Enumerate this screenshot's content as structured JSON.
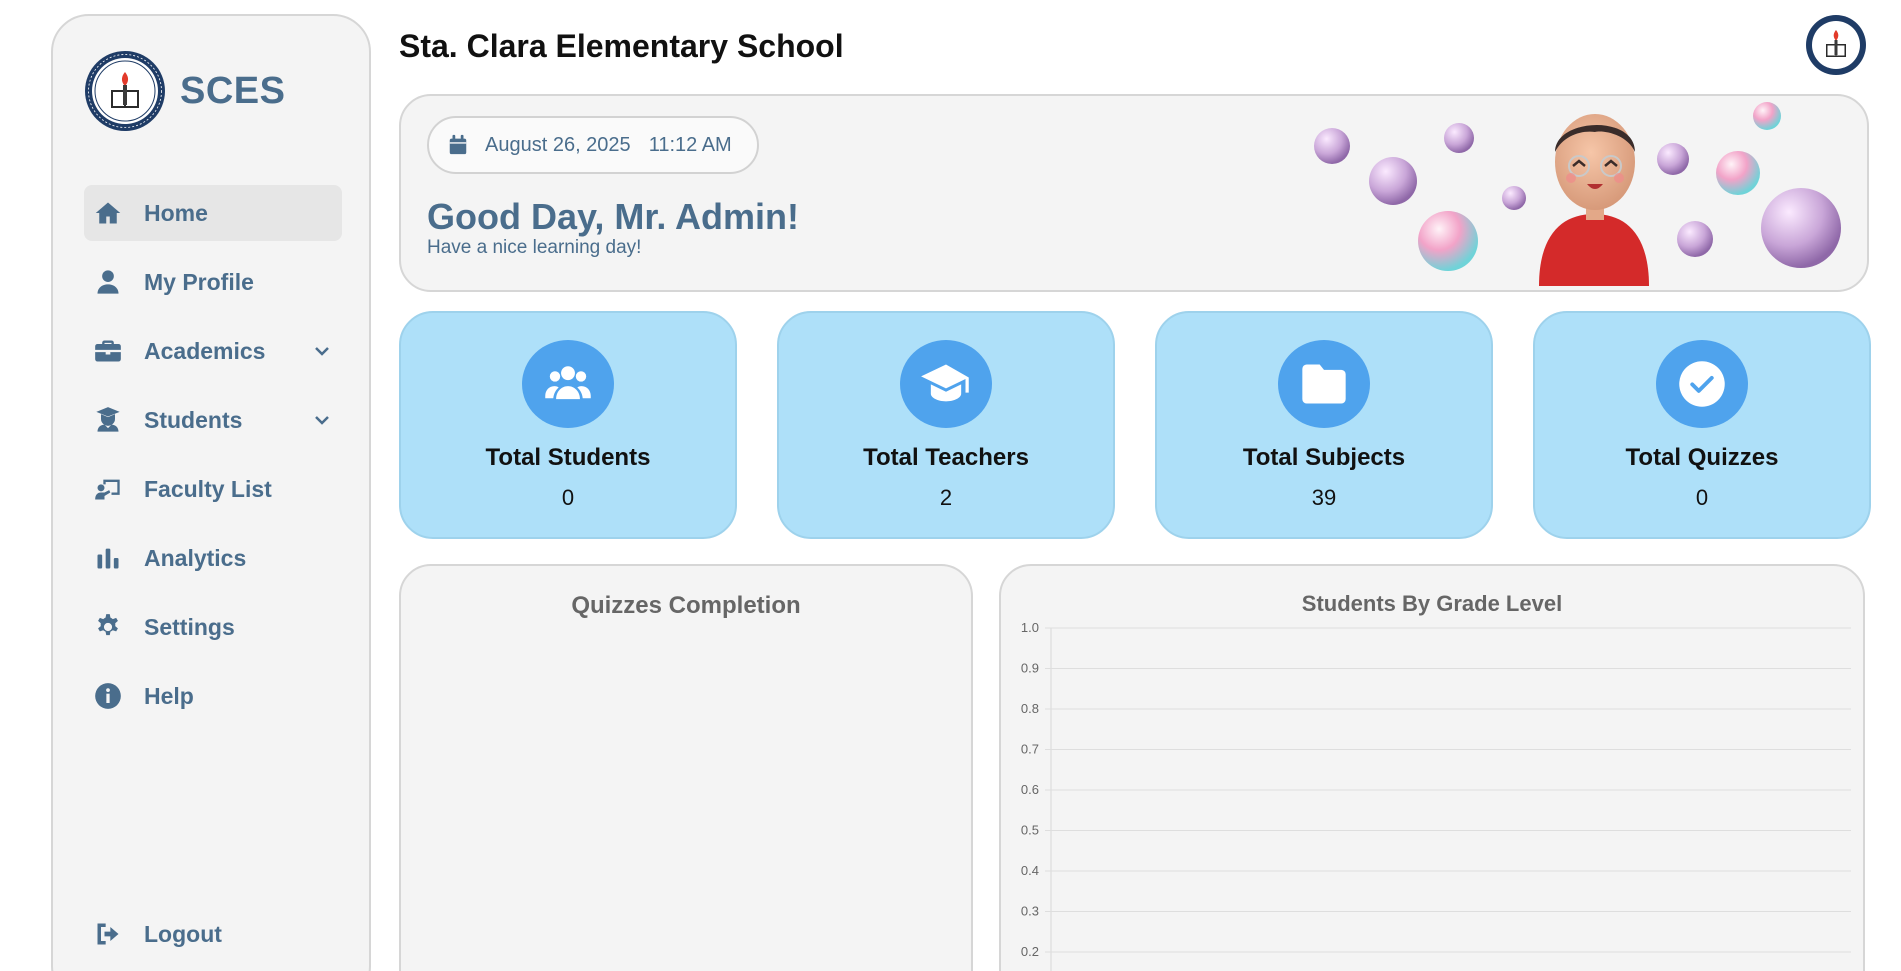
{
  "sidebar": {
    "brand": "SCES",
    "logo": "school-seal",
    "items": [
      {
        "label": "Home",
        "icon": "home-icon",
        "active": true
      },
      {
        "label": "My Profile",
        "icon": "user-icon"
      },
      {
        "label": "Academics",
        "icon": "briefcase-icon",
        "dropdown": true
      },
      {
        "label": "Students",
        "icon": "graduate-icon",
        "dropdown": true
      },
      {
        "label": "Faculty List",
        "icon": "chalkboard-teacher-icon"
      },
      {
        "label": "Analytics",
        "icon": "bar-chart-icon"
      },
      {
        "label": "Settings",
        "icon": "gear-icon"
      },
      {
        "label": "Help",
        "icon": "info-icon"
      }
    ],
    "logout": {
      "label": "Logout",
      "icon": "logout-icon"
    }
  },
  "header": {
    "title": "Sta. Clara Elementary School"
  },
  "banner": {
    "date": "August 26, 2025",
    "time": "11:12 AM",
    "greeting": "Good Day, Mr. Admin!",
    "subtitle": "Have a nice learning day!"
  },
  "stats": [
    {
      "label": "Total Students",
      "value": "0",
      "icon": "users-icon"
    },
    {
      "label": "Total Teachers",
      "value": "2",
      "icon": "graduation-cap-icon"
    },
    {
      "label": "Total Subjects",
      "value": "39",
      "icon": "folder-icon"
    },
    {
      "label": "Total Quizzes",
      "value": "0",
      "icon": "check-circle-icon"
    }
  ],
  "panels": {
    "quizzes_title": "Quizzes Completion",
    "grade_title": "Students By Grade Level"
  },
  "colors": {
    "accent": "#4a6d8c",
    "card_bg": "#aee0f9",
    "icon_circle": "#4fa3ed",
    "panel_bg": "#f4f4f4"
  },
  "chart_data": {
    "type": "bar",
    "title": "Students By Grade Level",
    "categories": [],
    "values": [],
    "ylim": [
      0,
      1.0
    ],
    "yticks": [
      "1.0",
      "0.9",
      "0.8",
      "0.7",
      "0.6",
      "0.5",
      "0.4",
      "0.3",
      "0.2"
    ],
    "grid": true
  }
}
